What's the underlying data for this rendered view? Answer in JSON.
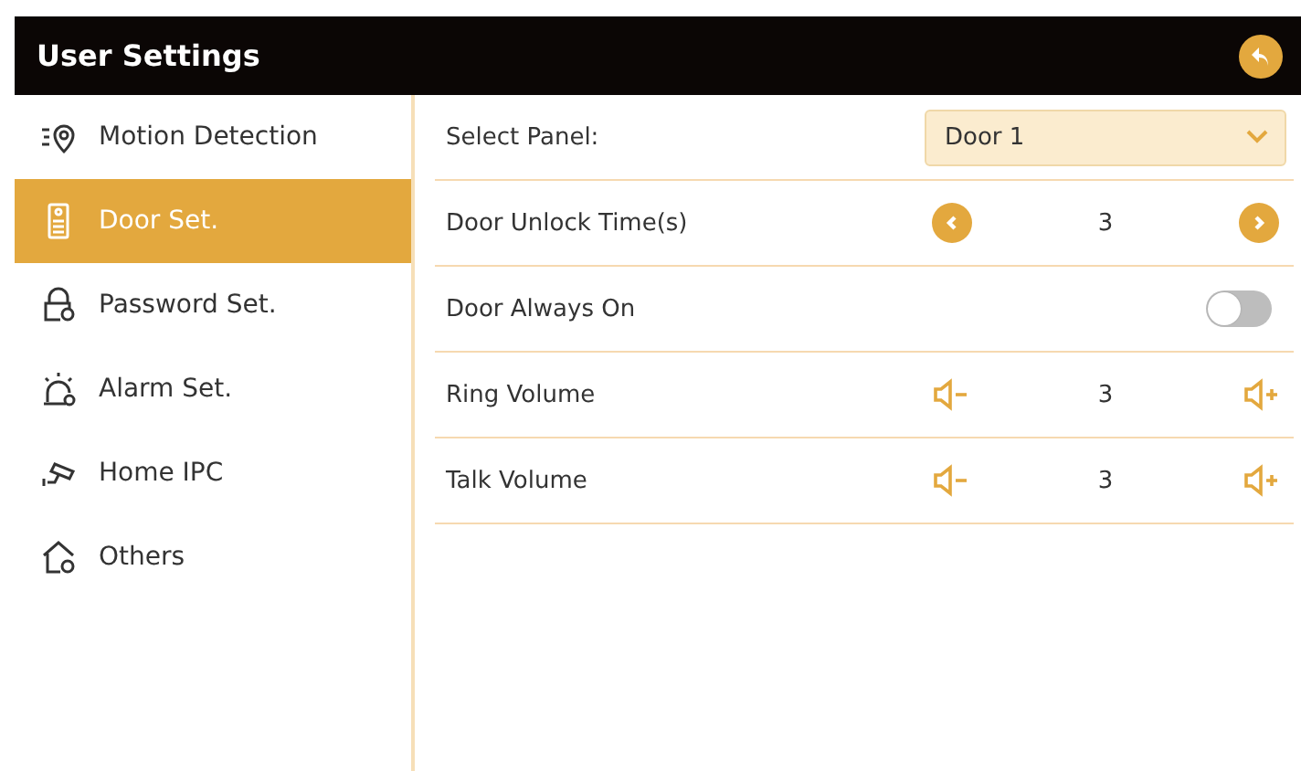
{
  "header": {
    "title": "User Settings"
  },
  "sidebar": {
    "items": [
      {
        "label": "Motion Detection",
        "kind": "motion",
        "selected": false
      },
      {
        "label": "Door Set.",
        "kind": "door",
        "selected": true
      },
      {
        "label": "Password Set.",
        "kind": "lock",
        "selected": false
      },
      {
        "label": "Alarm Set.",
        "kind": "alarm",
        "selected": false
      },
      {
        "label": "Home IPC",
        "kind": "camera",
        "selected": false
      },
      {
        "label": "Others",
        "kind": "home",
        "selected": false
      }
    ]
  },
  "settings": [
    {
      "kind": "select",
      "label": "Select Panel:",
      "value": "Door 1"
    },
    {
      "kind": "stepper",
      "label": "Door Unlock Time(s)",
      "value": "3"
    },
    {
      "kind": "toggle",
      "label": "Door Always On",
      "on": false
    },
    {
      "kind": "volume",
      "label": "Ring Volume",
      "value": "3"
    },
    {
      "kind": "volume",
      "label": "Talk Volume",
      "value": "3"
    }
  ]
}
